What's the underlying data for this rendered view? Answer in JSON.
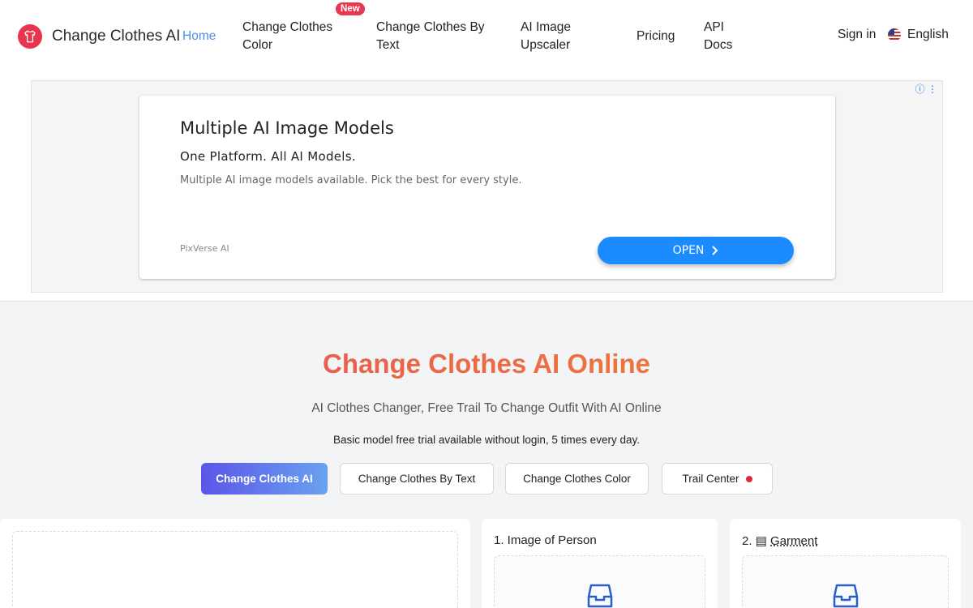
{
  "header": {
    "brand": "Change Clothes AI",
    "nav": {
      "home": "Home",
      "change_color": "Change Clothes Color",
      "new_badge": "New",
      "change_text": "Change Clothes By Text",
      "upscaler": "AI Image Upscaler",
      "pricing": "Pricing",
      "api_docs": "API Docs"
    },
    "sign_in": "Sign in",
    "language": "English"
  },
  "ad": {
    "title": "Multiple AI Image Models",
    "subtitle": "One Platform. All AI Models.",
    "description": "Multiple AI image models available. Pick the best for every style.",
    "source": "PixVerse AI",
    "button": "OPEN"
  },
  "hero": {
    "title": "Change Clothes AI Online",
    "subtitle": "AI Clothes Changer, Free Trail To Change Outfit With AI Online",
    "note": "Basic model free trial available without login, 5 times every day."
  },
  "tabs": {
    "ai": "Change Clothes AI",
    "by_text": "Change Clothes By Text",
    "color": "Change Clothes Color",
    "trail": "Trail Center"
  },
  "panels": {
    "person_label": "1. Image of Person",
    "garment_number": "2.",
    "garment_label": "Garment"
  },
  "colors": {
    "accent": "#4a90e2",
    "brand": "#e8344f",
    "tab_active_start": "#5b55e8",
    "tab_active_end": "#6aa2f0",
    "ad_button": "#1a8cff"
  }
}
